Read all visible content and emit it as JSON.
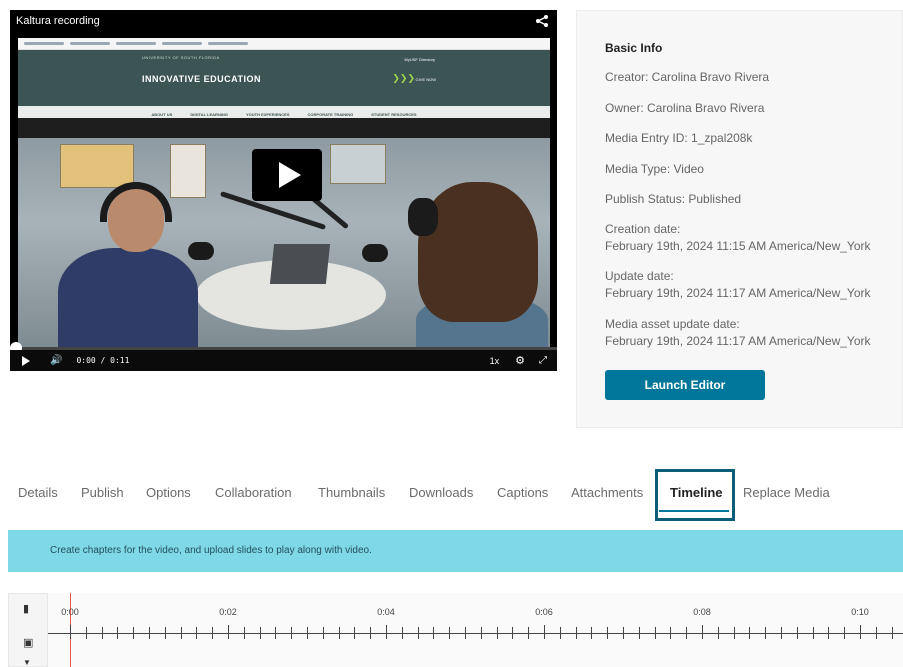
{
  "player": {
    "title": "Kaltura recording",
    "time": "0:00  / 0:11",
    "speed": "1x",
    "progress_fraction": 0,
    "site": {
      "university": "UNIVERSITY OF SOUTH FLORIDA",
      "title": "INNOVATIVE EDUCATION",
      "myusf": "MyUSF  Directory",
      "give": "GIVE NOW",
      "nav": [
        "ABOUT US",
        "DIGITAL LEARNING",
        "YOUTH EXPERIENCES",
        "CORPORATE TRAINING",
        "STUDENT RESOURCES"
      ]
    }
  },
  "info": {
    "heading": "Basic Info",
    "creator": "Creator: Carolina Bravo Rivera",
    "owner": "Owner: Carolina Bravo Rivera",
    "entry_id": "Media Entry ID: 1_zpal208k",
    "media_type": "Media Type: Video",
    "publish_status": "Publish Status: Published",
    "creation_label": "Creation date:",
    "creation_value": "February 19th, 2024 11:15 AM America/New_York",
    "update_label": "Update date:",
    "update_value": "February 19th, 2024 11:17 AM America/New_York",
    "asset_label": "Media asset update date:",
    "asset_value": "February 19th, 2024 11:17 AM America/New_York",
    "launch_button": "Launch Editor"
  },
  "tabs": [
    {
      "label": "Details",
      "active": false
    },
    {
      "label": "Publish",
      "active": false
    },
    {
      "label": "Options",
      "active": false
    },
    {
      "label": "Collaboration",
      "active": false
    },
    {
      "label": "Thumbnails",
      "active": false
    },
    {
      "label": "Downloads",
      "active": false
    },
    {
      "label": "Captions",
      "active": false
    },
    {
      "label": "Attachments",
      "active": false
    },
    {
      "label": "Timeline",
      "active": true
    },
    {
      "label": "Replace Media",
      "active": false
    }
  ],
  "banner": "Create chapters for the video, and upload slides to play along with video.",
  "timeline": {
    "labels": [
      "0:00",
      "0:02",
      "0:04",
      "0:06",
      "0:08",
      "0:10"
    ],
    "cursor_time": "0:00"
  },
  "colors": {
    "accent": "#00779a",
    "banner_bg": "#7fd8e6",
    "cursor": "#e8584c",
    "focus_outline": "#0d5c78"
  },
  "icons": {
    "share": "share-icon",
    "play": "play-icon",
    "volume": "volume-icon",
    "settings": "gear-icon",
    "fullscreen": "fullscreen-icon",
    "bookmark": "bookmark-icon",
    "slides": "file-icon"
  }
}
